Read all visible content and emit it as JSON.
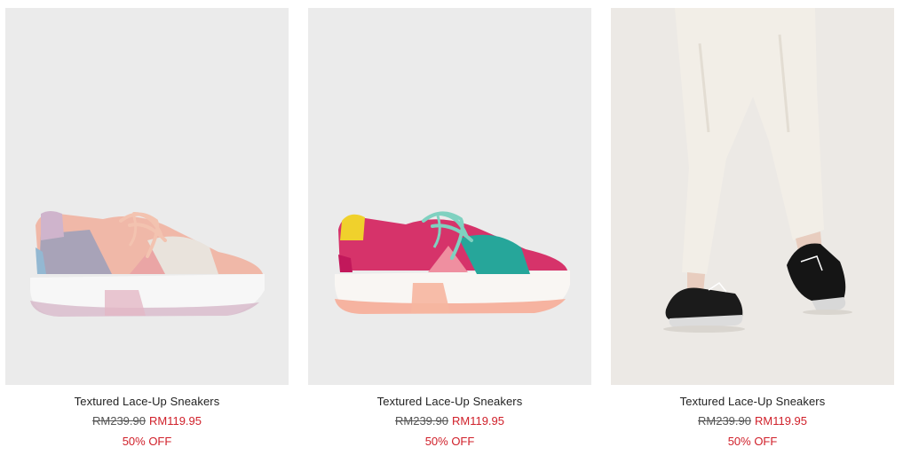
{
  "products": [
    {
      "name": "Textured Lace-Up Sneakers",
      "original_price": "RM239.90",
      "sale_price": "RM119.95",
      "discount": "50% OFF",
      "image_icon": "pastel-sneaker-image"
    },
    {
      "name": "Textured Lace-Up Sneakers",
      "original_price": "RM239.90",
      "sale_price": "RM119.95",
      "discount": "50% OFF",
      "image_icon": "bright-sneaker-image"
    },
    {
      "name": "Textured Lace-Up Sneakers",
      "original_price": "RM239.90",
      "sale_price": "RM119.95",
      "discount": "50% OFF",
      "image_icon": "model-wearing-black-sneakers-image"
    }
  ],
  "colors": {
    "sale_red": "#d0202a",
    "image_bg": "#ebebeb"
  }
}
